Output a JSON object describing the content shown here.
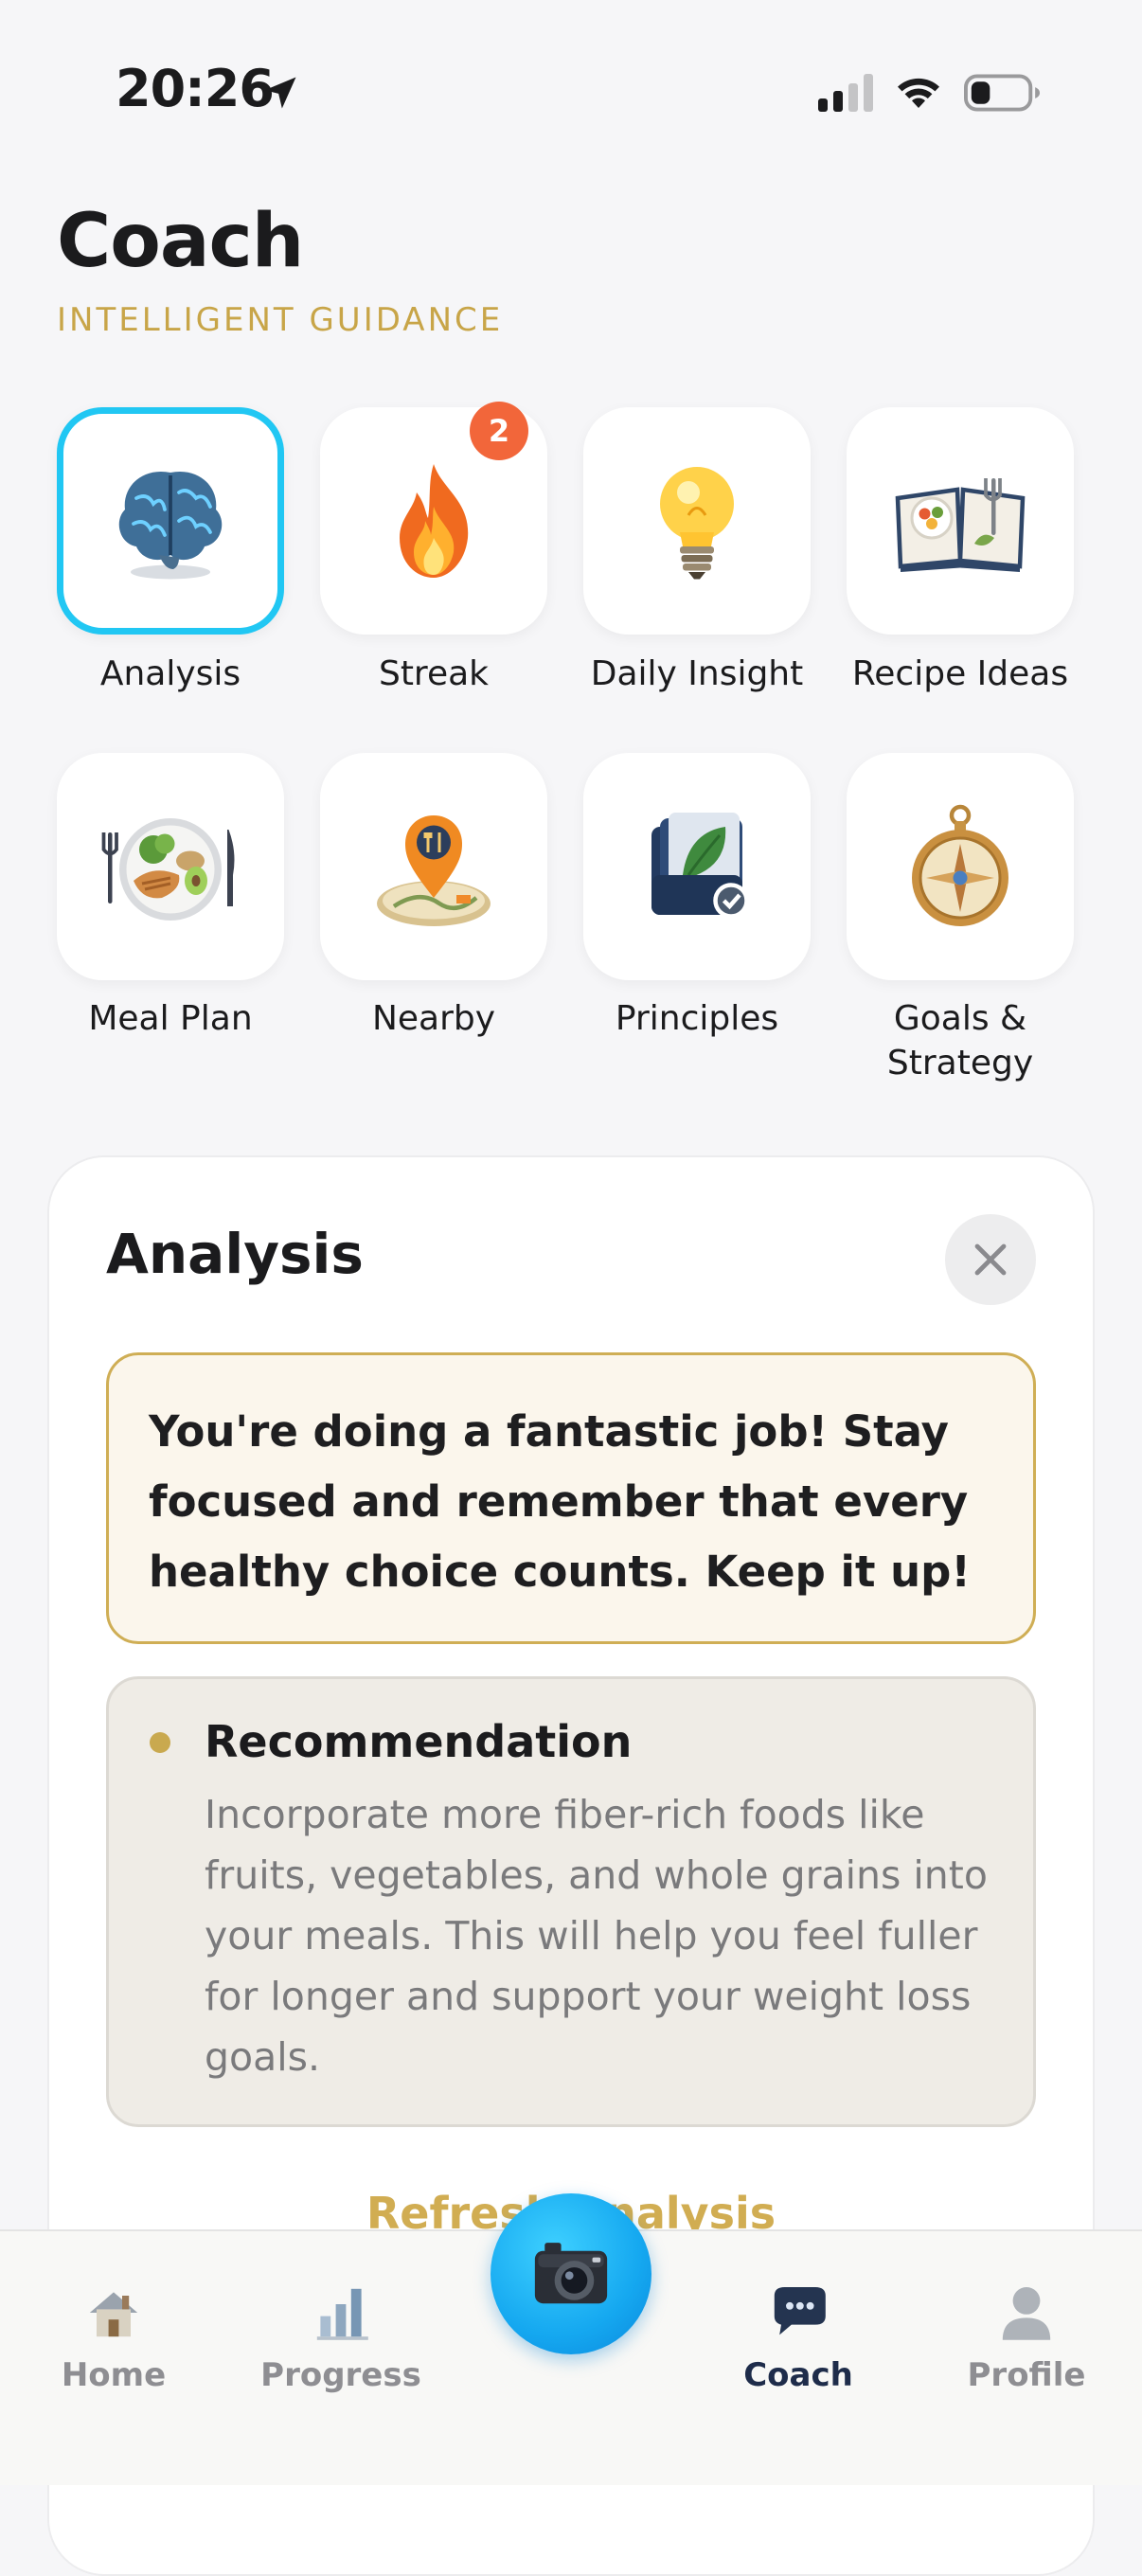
{
  "status_bar": {
    "time": "20:26"
  },
  "header": {
    "title": "Coach",
    "subtitle": "INTELLIGENT GUIDANCE"
  },
  "tiles": [
    {
      "label": "Analysis",
      "icon": "brain-icon",
      "selected": true
    },
    {
      "label": "Streak",
      "icon": "flame-icon",
      "badge": "2"
    },
    {
      "label": "Daily Insight",
      "icon": "lightbulb-icon"
    },
    {
      "label": "Recipe Ideas",
      "icon": "recipe-book-icon"
    },
    {
      "label": "Meal Plan",
      "icon": "meal-plate-icon"
    },
    {
      "label": "Nearby",
      "icon": "map-pin-icon"
    },
    {
      "label": "Principles",
      "icon": "principles-book-icon"
    },
    {
      "label": "Goals & Strategy",
      "icon": "compass-icon"
    }
  ],
  "panel": {
    "title": "Analysis",
    "message": "You're doing a fantastic job! Stay focused and remember that every healthy choice counts. Keep it up!",
    "recommendation": {
      "title": "Recommendation",
      "body": "Incorporate more fiber-rich foods like fruits, vegetables, and whole grains into your meals. This will help you feel fuller for longer and support your weight loss goals."
    },
    "refresh_label": "Refresh Analysis"
  },
  "tabbar": {
    "items": [
      {
        "label": "Home",
        "icon": "house-icon"
      },
      {
        "label": "Progress",
        "icon": "bar-chart-icon"
      },
      {
        "label": "Coach",
        "icon": "chat-bubble-icon",
        "active": true
      },
      {
        "label": "Profile",
        "icon": "person-icon"
      }
    ],
    "camera_icon": "camera-icon"
  },
  "colors": {
    "accent_gold": "#c8a548",
    "selected_border": "#21c7f3",
    "badge": "#f2663a",
    "camera_button": "#15a8f0"
  }
}
